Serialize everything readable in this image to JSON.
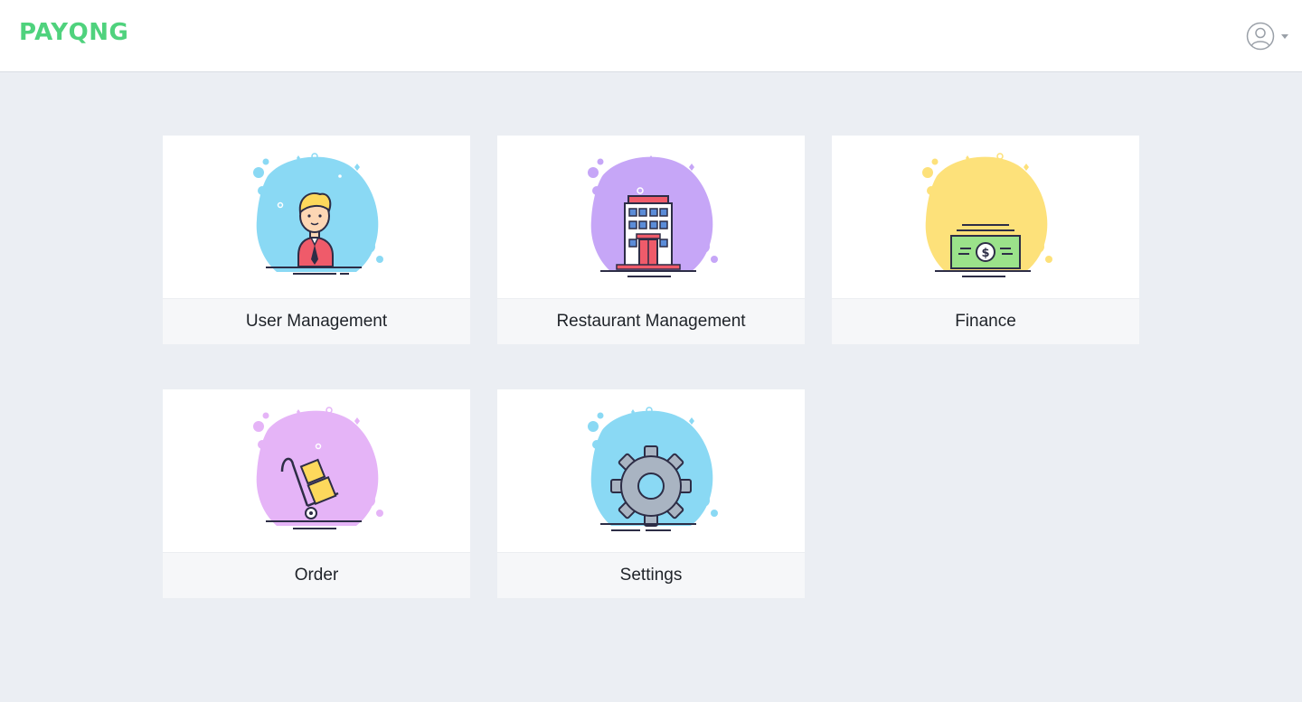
{
  "app": {
    "brand": "PAYQNG",
    "brand_color": "#4fd27d"
  },
  "header": {
    "user_icon": "user-avatar-icon",
    "menu_icon": "caret-down-icon"
  },
  "modules": [
    {
      "label": "User Management",
      "icon": "businessman-icon",
      "blob_color": "#8ad9f4"
    },
    {
      "label": "Restaurant Management",
      "icon": "building-icon",
      "blob_color": "#c6a6f7"
    },
    {
      "label": "Finance",
      "icon": "money-bill-icon",
      "blob_color": "#fde17a"
    },
    {
      "label": "Order",
      "icon": "hand-truck-icon",
      "blob_color": "#e5b4f7"
    },
    {
      "label": "Settings",
      "icon": "gear-icon",
      "blob_color": "#8ad9f4"
    }
  ]
}
